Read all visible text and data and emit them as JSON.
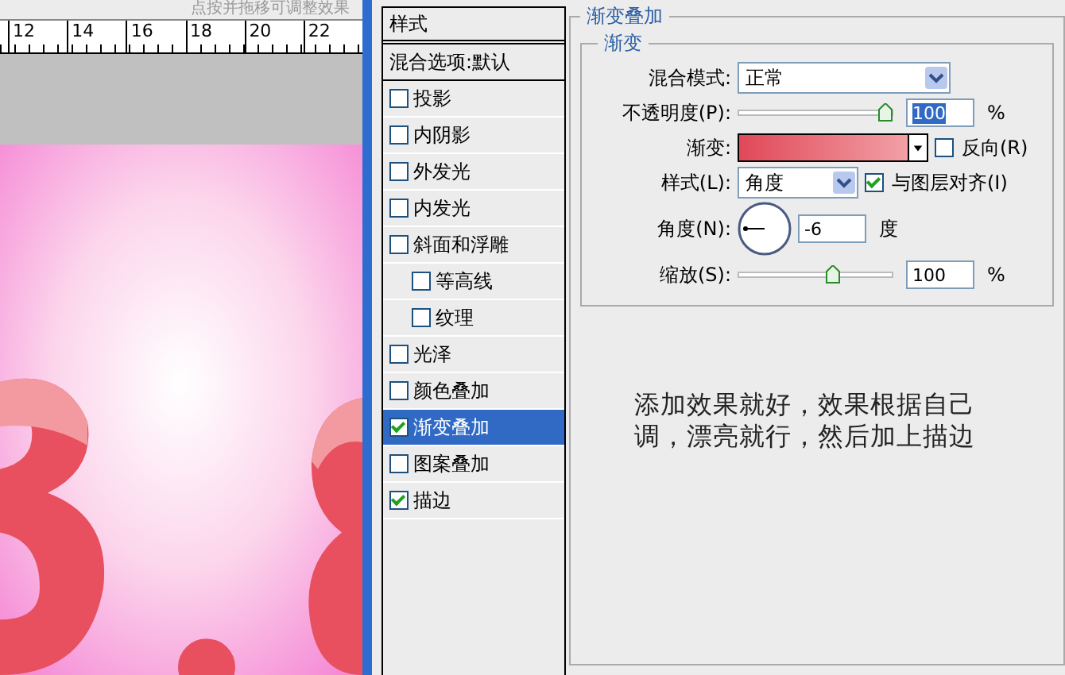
{
  "canvas": {
    "hint": "点按并拖移可调整效果",
    "ruler_ticks": [
      "12",
      "14",
      "16",
      "18",
      "20",
      "22"
    ]
  },
  "styles_panel": {
    "title": "样式",
    "blend_default": "混合选项:默认",
    "items": [
      {
        "label": "投影",
        "checked": false,
        "selected": false
      },
      {
        "label": "内阴影",
        "checked": false,
        "selected": false
      },
      {
        "label": "外发光",
        "checked": false,
        "selected": false
      },
      {
        "label": "内发光",
        "checked": false,
        "selected": false
      },
      {
        "label": "斜面和浮雕",
        "checked": false,
        "selected": false,
        "children": [
          {
            "label": "等高线",
            "checked": false,
            "selected": false
          },
          {
            "label": "纹理",
            "checked": false,
            "selected": false
          }
        ]
      },
      {
        "label": "光泽",
        "checked": false,
        "selected": false
      },
      {
        "label": "颜色叠加",
        "checked": false,
        "selected": false
      },
      {
        "label": "渐变叠加",
        "checked": true,
        "selected": true
      },
      {
        "label": "图案叠加",
        "checked": false,
        "selected": false
      },
      {
        "label": "描边",
        "checked": true,
        "selected": false
      }
    ]
  },
  "gradient_overlay": {
    "title": "渐变叠加",
    "group_title": "渐变",
    "blend_mode": {
      "label": "混合模式:",
      "value": "正常"
    },
    "opacity": {
      "label": "不透明度(P):",
      "level": 1,
      "value": "100",
      "unit": "%"
    },
    "gradient": {
      "label": "渐变:",
      "reverse_label": "反向(R)",
      "reverse": false
    },
    "style": {
      "label": "样式(L):",
      "value": "角度",
      "align_label": "与图层对齐(I)",
      "align": true
    },
    "angle": {
      "label": "角度(N):",
      "value": "-6",
      "unit": "度"
    },
    "scale": {
      "label": "缩放(S):",
      "level": 0.62,
      "value": "100",
      "unit": "%"
    }
  },
  "note": [
    "添加效果就好，效果根据自己",
    "调，漂亮就行，然后加上描边"
  ]
}
